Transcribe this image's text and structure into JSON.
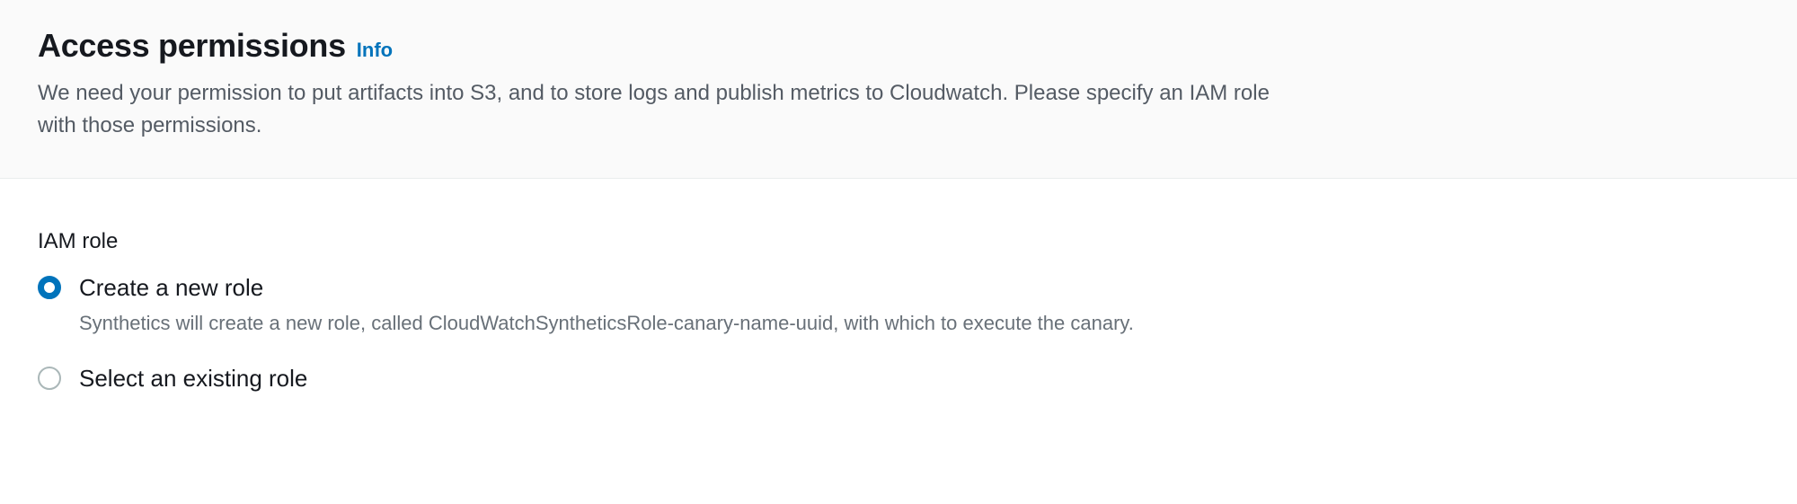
{
  "header": {
    "title": "Access permissions",
    "info_link": "Info",
    "description": "We need your permission to put artifacts into S3, and to store logs and publish metrics to Cloudwatch. Please specify an IAM role with those permissions."
  },
  "iam_role": {
    "label": "IAM role",
    "options": [
      {
        "label": "Create a new role",
        "description": "Synthetics will create a new role, called CloudWatchSyntheticsRole-canary-name-uuid, with which to execute the canary.",
        "selected": true
      },
      {
        "label": "Select an existing role",
        "description": "",
        "selected": false
      }
    ]
  }
}
